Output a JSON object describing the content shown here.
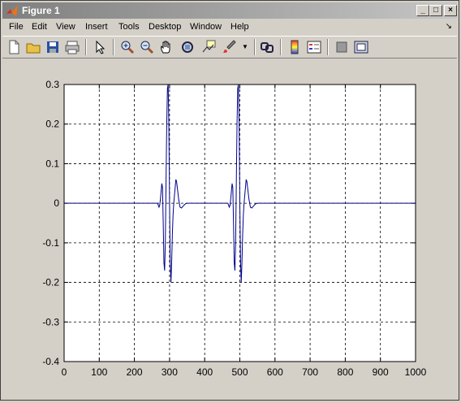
{
  "window": {
    "title": "Figure 1",
    "minimize_label": "_",
    "maximize_label": "□",
    "close_label": "×"
  },
  "menu": {
    "items": [
      "File",
      "Edit",
      "View",
      "Insert",
      "Tools",
      "Desktop",
      "Window",
      "Help"
    ],
    "dock_arrow": "↘"
  },
  "toolbar": {
    "buttons": [
      "new-figure",
      "open-file",
      "save-figure",
      "print-figure",
      "edit-plot",
      "zoom-in",
      "zoom-out",
      "pan",
      "rotate-3d",
      "data-cursor",
      "brush",
      "brush-menu",
      "link-plot",
      "insert-colorbar",
      "insert-legend",
      "hide-plot-tools",
      "show-plot-tools"
    ]
  },
  "colors": {
    "line": "#00008b",
    "grid": "#000000",
    "figure_bg": "#d4d0c8",
    "axes_bg": "#ffffff"
  },
  "chart_data": {
    "type": "line",
    "title": "",
    "xlabel": "",
    "ylabel": "",
    "xlim": [
      0,
      1000
    ],
    "ylim": [
      -0.4,
      0.3
    ],
    "grid": true,
    "xticks": [
      0,
      100,
      200,
      300,
      400,
      500,
      600,
      700,
      800,
      900,
      1000
    ],
    "yticks": [
      -0.4,
      -0.3,
      -0.2,
      -0.1,
      0,
      0.1,
      0.2,
      0.3
    ],
    "xtick_labels": [
      "0",
      "100",
      "200",
      "300",
      "400",
      "500",
      "600",
      "700",
      "800",
      "900",
      "1000"
    ],
    "ytick_labels": [
      "-0.4",
      "-0.3",
      "-0.2",
      "-0.1",
      "0",
      "0.1",
      "0.2",
      "0.3"
    ],
    "series": [
      {
        "x": [
          0,
          266,
          268,
          270,
          272,
          274,
          276,
          278,
          280,
          282,
          284,
          286,
          288,
          290,
          292,
          294,
          296,
          298,
          300,
          302,
          304,
          306,
          308,
          310,
          312,
          314,
          316,
          318,
          320,
          322,
          324,
          326,
          328,
          330,
          334,
          338,
          342,
          346,
          350,
          356,
          360,
          466,
          468,
          470,
          472,
          474,
          476,
          478,
          480,
          482,
          484,
          486,
          488,
          490,
          492,
          494,
          496,
          498,
          500,
          502,
          504,
          506,
          508,
          510,
          512,
          514,
          516,
          518,
          520,
          522,
          524,
          526,
          528,
          530,
          534,
          538,
          542,
          546,
          550,
          556,
          560,
          1000
        ],
        "y": [
          0,
          0,
          -0.005,
          -0.01,
          -0.005,
          0.01,
          0.03,
          0.05,
          0.04,
          -0.05,
          -0.15,
          -0.17,
          -0.1,
          0.05,
          0.2,
          0.29,
          0.3,
          0.2,
          0.0,
          -0.15,
          -0.2,
          -0.15,
          -0.08,
          -0.03,
          0.0,
          0.02,
          0.04,
          0.06,
          0.055,
          0.04,
          0.025,
          0.01,
          0.0,
          -0.01,
          -0.012,
          -0.008,
          -0.004,
          -0.001,
          0.0,
          0.0,
          0.0,
          0,
          -0.005,
          -0.01,
          -0.005,
          0.01,
          0.03,
          0.05,
          0.04,
          -0.05,
          -0.15,
          -0.17,
          -0.1,
          0.05,
          0.2,
          0.29,
          0.3,
          0.2,
          0.0,
          -0.15,
          -0.2,
          -0.15,
          -0.08,
          -0.03,
          0.0,
          0.02,
          0.04,
          0.06,
          0.055,
          0.04,
          0.025,
          0.01,
          0.0,
          -0.01,
          -0.012,
          -0.008,
          -0.004,
          -0.001,
          0.0,
          0.0,
          0.0,
          0
        ]
      }
    ]
  }
}
